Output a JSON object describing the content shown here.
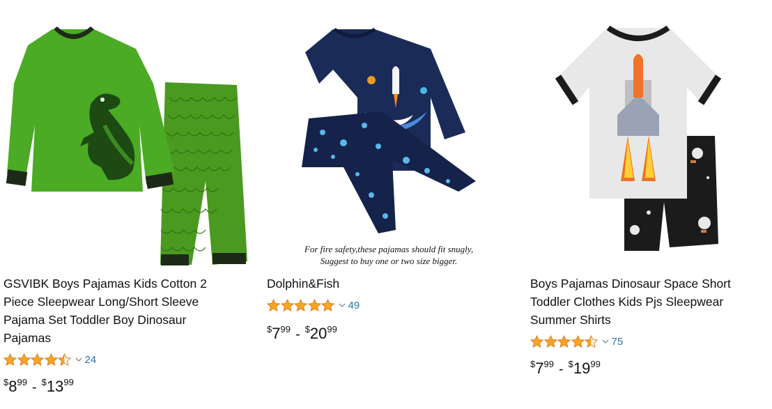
{
  "products": [
    {
      "title": "GSVIBK Boys Pajamas Kids Cotton 2 Piece Sleepwear Long/Short Sleeve Pajama Set Toddler Boy Dinosaur Pajamas",
      "rating_value": 4.5,
      "rating_count": "24",
      "price_low": {
        "symbol": "$",
        "whole": "8",
        "fraction": "99"
      },
      "price_high": {
        "symbol": "$",
        "whole": "13",
        "fraction": "99"
      },
      "image_icon": "dinosaur-pajama-image"
    },
    {
      "title": "Dolphin&Fish",
      "rating_value": 5,
      "rating_count": "49",
      "price_low": {
        "symbol": "$",
        "whole": "7",
        "fraction": "99"
      },
      "price_high": {
        "symbol": "$",
        "whole": "20",
        "fraction": "99"
      },
      "image_icon": "rocket-pajama-image",
      "image_caption": [
        "For fire safety,these pajamas should fit snugly,",
        "Suggest to buy one or two size bigger."
      ]
    },
    {
      "title": "Boys Pajamas Dinosaur Space Short Toddler Clothes Kids Pjs Sleepwear Summer Shirts",
      "rating_value": 4.5,
      "rating_count": "75",
      "price_low": {
        "symbol": "$",
        "whole": "7",
        "fraction": "99"
      },
      "price_high": {
        "symbol": "$",
        "whole": "19",
        "fraction": "99"
      },
      "image_icon": "space-shuttle-pajama-image"
    }
  ],
  "colors": {
    "star": "#f5a623",
    "link": "#2a73a8",
    "text": "#0f1111"
  }
}
